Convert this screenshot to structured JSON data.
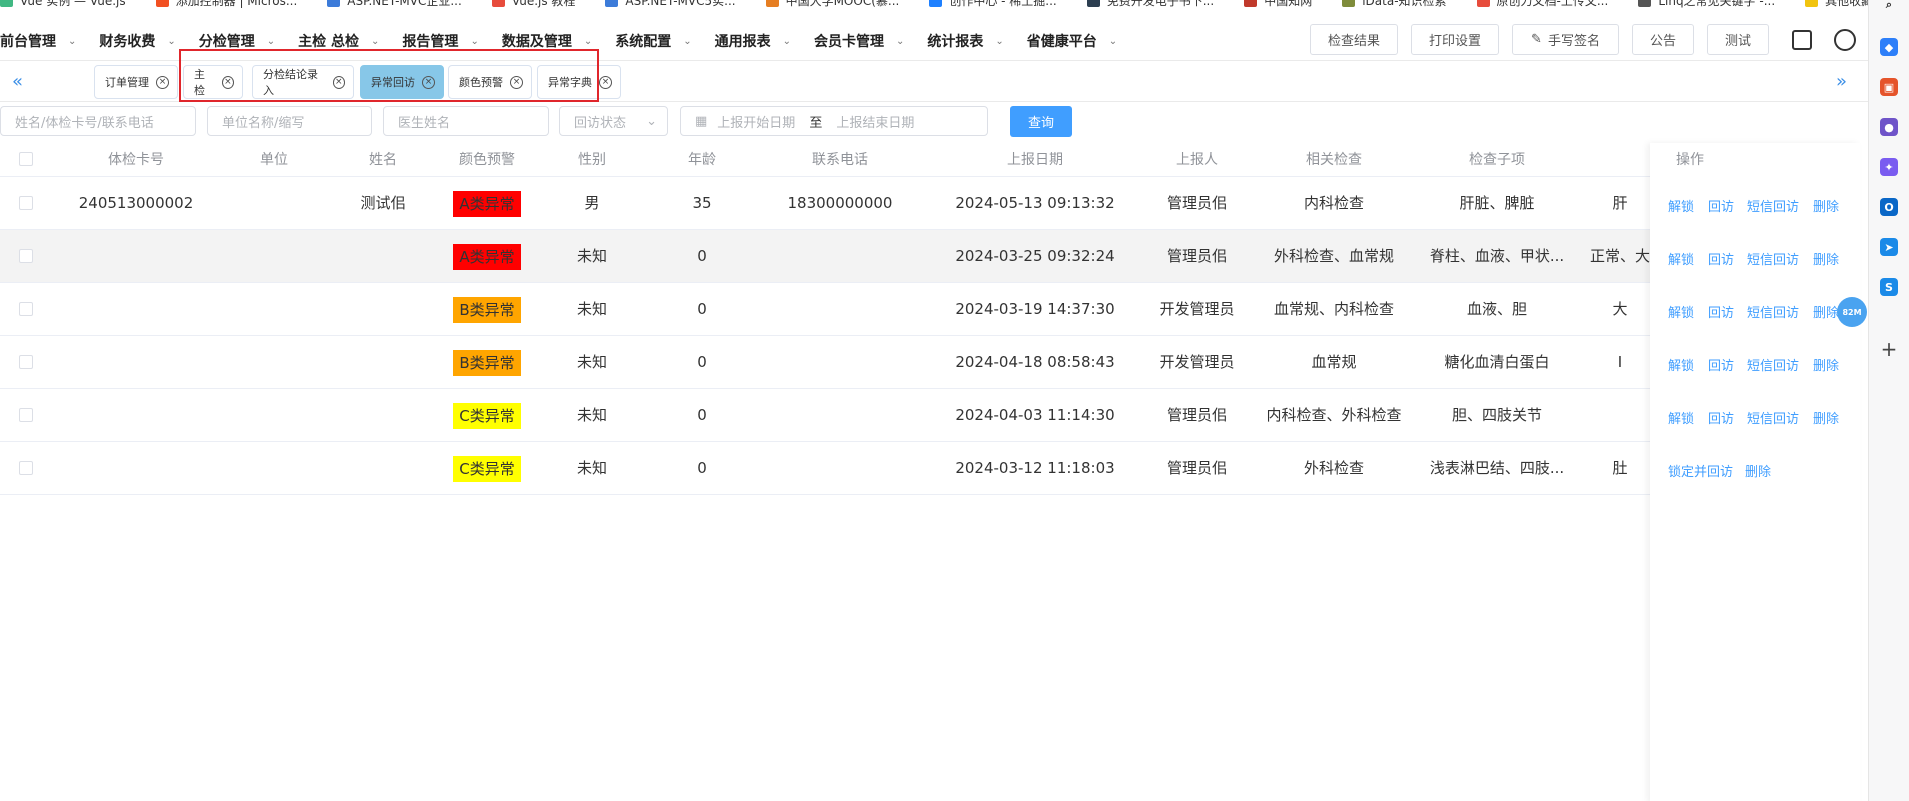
{
  "bookmarks": [
    {
      "label": "Vue 实例 — Vue.js",
      "color": "#41b883"
    },
    {
      "label": "添加控制器 | Micros...",
      "color": "#f25022"
    },
    {
      "label": "ASP.NET-MVC企业...",
      "color": "#3c7bd9"
    },
    {
      "label": "Vue.js 教程",
      "color": "#e74c3c"
    },
    {
      "label": "ASP.NET-MVC5实...",
      "color": "#3c7bd9"
    },
    {
      "label": "中国大学MOOC(慕...",
      "color": "#e67e22"
    },
    {
      "label": "创作中心 - 稀土掘...",
      "color": "#1e80ff"
    },
    {
      "label": "免费开发电子书下...",
      "color": "#2c3e50"
    },
    {
      "label": "中国知网",
      "color": "#c0392b"
    },
    {
      "label": "iData-知识检索",
      "color": "#7f8c3b"
    },
    {
      "label": "原创力文档-上传文...",
      "color": "#e74c3c"
    },
    {
      "label": "Linq之常见关键字 -...",
      "color": "#555555"
    },
    {
      "label": "其他收藏夹",
      "color": "#f1c40f"
    }
  ],
  "nav": {
    "items": [
      "前台管理",
      "财务收费",
      "分检管理",
      "主检 总检",
      "报告管理",
      "数据及管理",
      "系统配置",
      "通用报表",
      "会员卡管理",
      "统计报表",
      "省健康平台"
    ],
    "buttons": {
      "results": "检查结果",
      "print": "打印设置",
      "signature": "手写签名",
      "notice": "公告",
      "test": "测试"
    }
  },
  "tabs": [
    {
      "label": "订单管理",
      "active": false
    },
    {
      "label": "主检",
      "active": false
    },
    {
      "label": "分检结论录入",
      "active": false
    },
    {
      "label": "异常回访",
      "active": true
    },
    {
      "label": "颜色预警",
      "active": false
    },
    {
      "label": "异常字典",
      "active": false
    }
  ],
  "filters": {
    "name_placeholder": "姓名/体检卡号/联系电话",
    "unit_placeholder": "单位名称/缩写",
    "doctor_placeholder": "医生姓名",
    "status_placeholder": "回访状态",
    "start_placeholder": "上报开始日期",
    "range_sep": "至",
    "end_placeholder": "上报结束日期",
    "query": "查询"
  },
  "table": {
    "headers": [
      "体检卡号",
      "单位",
      "姓名",
      "颜色预警",
      "性别",
      "年龄",
      "联系电话",
      "上报日期",
      "上报人",
      "相关检查",
      "检查子项",
      "操作"
    ],
    "rows": [
      {
        "card": "240513000002",
        "unit": "",
        "name": "测试佀",
        "warn": "A类异常",
        "warn_color": "#ff0000",
        "sex": "男",
        "age": "35",
        "phone": "18300000000",
        "date": "2024-05-13 09:13:32",
        "reporter": "管理员佀",
        "related": "内科检查",
        "sub": "肝脏、脾脏",
        "result": "肝",
        "ops": [
          "解锁",
          "回访",
          "短信回访",
          "删除"
        ]
      },
      {
        "card": "",
        "unit": "",
        "name": "",
        "warn": "A类异常",
        "warn_color": "#ff0000",
        "sex": "未知",
        "age": "0",
        "phone": "",
        "date": "2024-03-25 09:32:24",
        "reporter": "管理员佀",
        "related": "外科检查、血常规",
        "sub": "脊柱、血液、甲状...",
        "result": "正常、大",
        "ops": [
          "解锁",
          "回访",
          "短信回访",
          "删除"
        ]
      },
      {
        "card": "",
        "unit": "",
        "name": "",
        "warn": "B类异常",
        "warn_color": "#ffa500",
        "sex": "未知",
        "age": "0",
        "phone": "",
        "date": "2024-03-19 14:37:30",
        "reporter": "开发管理员",
        "related": "血常规、内科检查",
        "sub": "血液、胆",
        "result": "大",
        "ops": [
          "解锁",
          "回访",
          "短信回访",
          "删除"
        ]
      },
      {
        "card": "",
        "unit": "",
        "name": "",
        "warn": "B类异常",
        "warn_color": "#ffa500",
        "sex": "未知",
        "age": "0",
        "phone": "",
        "date": "2024-04-18 08:58:43",
        "reporter": "开发管理员",
        "related": "血常规",
        "sub": "糖化血清白蛋白",
        "result": "I",
        "ops": [
          "解锁",
          "回访",
          "短信回访",
          "删除"
        ]
      },
      {
        "card": "",
        "unit": "",
        "name": "",
        "warn": "C类异常",
        "warn_color": "#ffff00",
        "sex": "未知",
        "age": "0",
        "phone": "",
        "date": "2024-04-03 11:14:30",
        "reporter": "管理员佀",
        "related": "内科检查、外科检查",
        "sub": "胆、四肢关节",
        "result": "",
        "ops": [
          "解锁",
          "回访",
          "短信回访",
          "删除"
        ]
      },
      {
        "card": "",
        "unit": "",
        "name": "",
        "warn": "C类异常",
        "warn_color": "#ffff00",
        "sex": "未知",
        "age": "0",
        "phone": "",
        "date": "2024-03-12 11:18:03",
        "reporter": "管理员佀",
        "related": "外科检查",
        "sub": "浅表淋巴结、四肢...",
        "result": "肚",
        "ops": [
          "锁定并回访",
          "删除"
        ]
      }
    ]
  },
  "float_badge": "82M"
}
